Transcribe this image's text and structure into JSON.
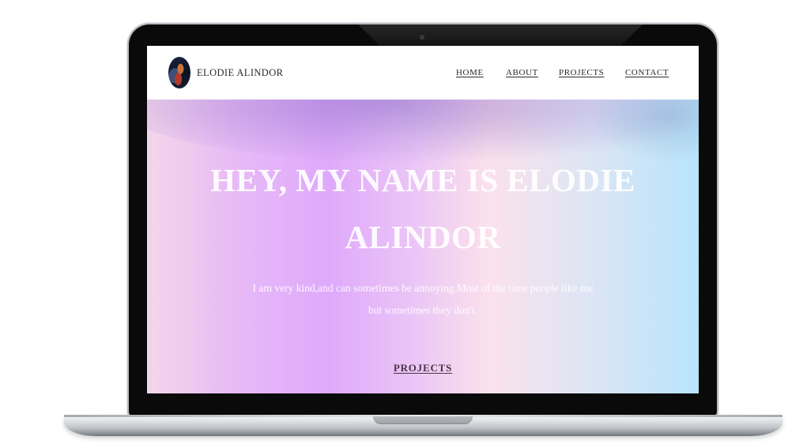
{
  "site": {
    "brand_name": "ELODIE ALINDOR"
  },
  "nav": {
    "items": [
      {
        "label": "HOME"
      },
      {
        "label": "ABOUT"
      },
      {
        "label": "PROJECTS"
      },
      {
        "label": "CONTACT"
      }
    ]
  },
  "hero": {
    "title": "HEY, MY NAME IS ELODIE ALINDOR",
    "subtitle": "I am very kind,and can sometimes be annoying.Most of the time people like me but sometimes they don't.",
    "cta_label": "PROJECTS"
  },
  "colors": {
    "gradient_stops": [
      "#f3d6ea",
      "#dfa9fb",
      "#fbe1ec",
      "#b8e4fb"
    ],
    "nav_text": "#2a2a2a",
    "cta_text": "#4a3346"
  }
}
